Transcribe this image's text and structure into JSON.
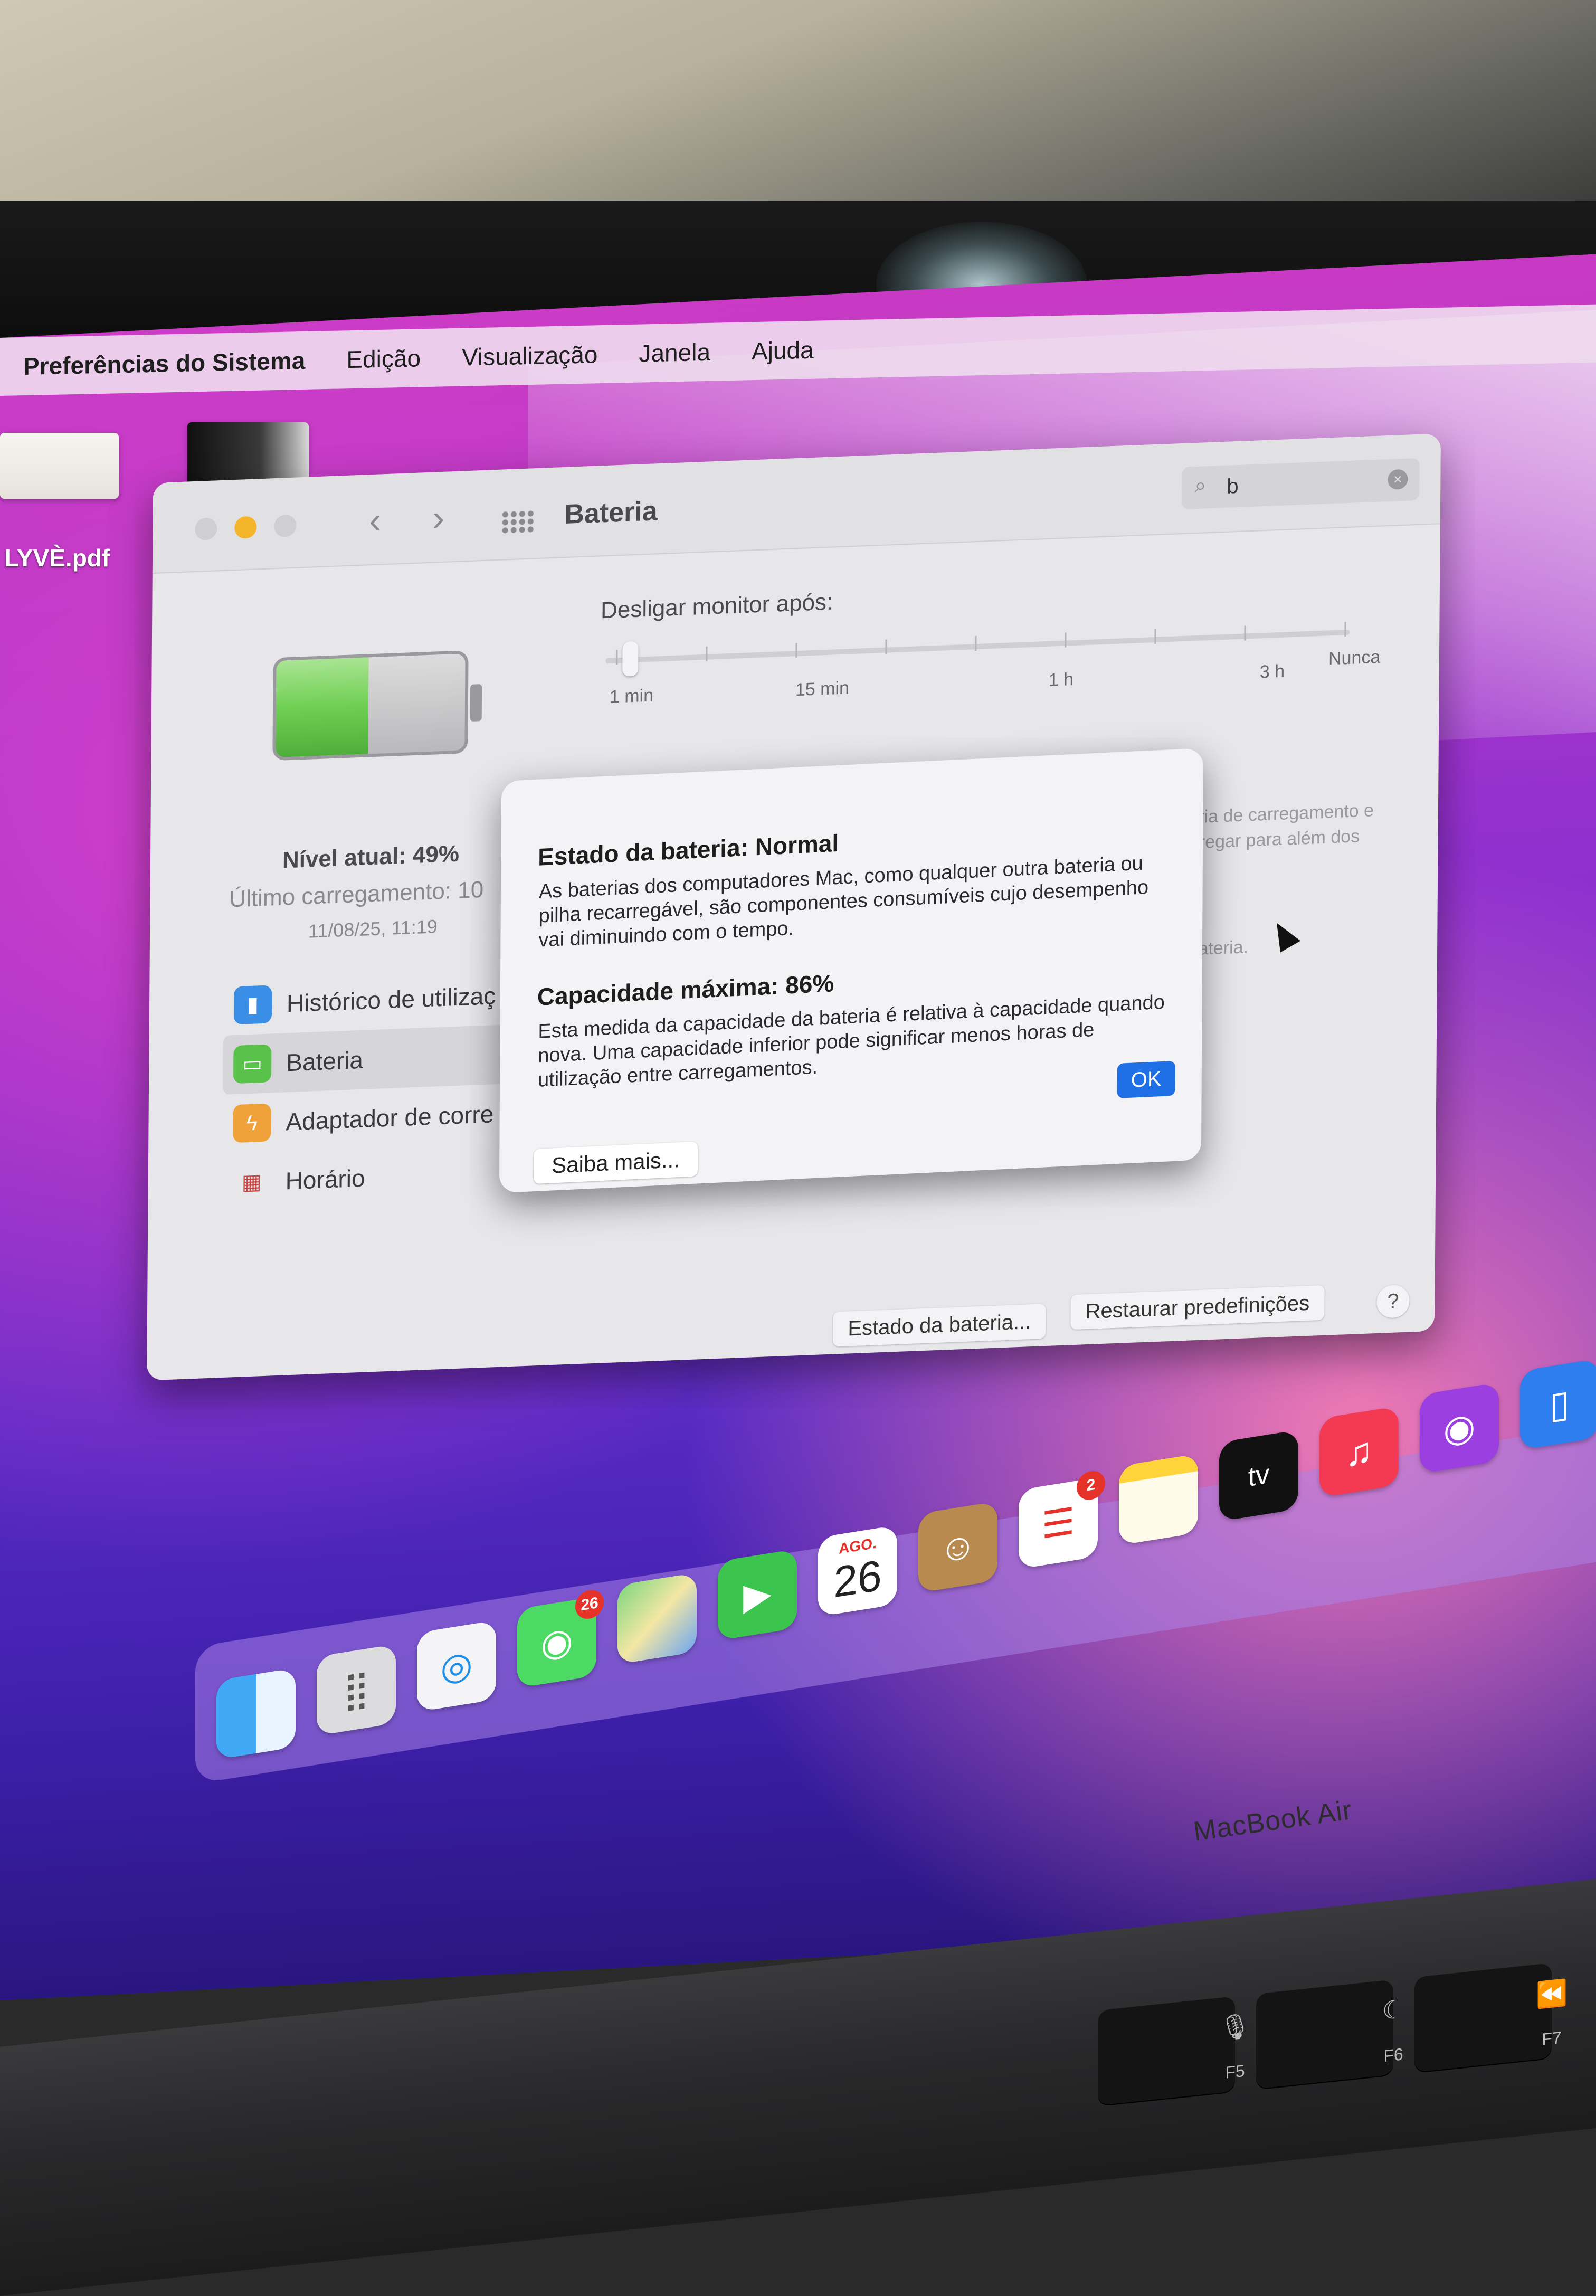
{
  "menubar": {
    "app_name": "Preferências do Sistema",
    "items": [
      "Edição",
      "Visualização",
      "Janela",
      "Ajuda"
    ]
  },
  "desktop": {
    "file_name": "LYVÈ.pdf"
  },
  "window": {
    "title": "Bateria",
    "search_query": "b",
    "battery": {
      "level_text": "Nível atual: 49%",
      "level_percent": 49,
      "last_charge_text": "Último carregamento: 10",
      "last_charge_date": "11/08/25, 11:19"
    },
    "slider": {
      "label": "Desligar monitor após:",
      "tick_labels": [
        "1 min",
        "15 min",
        "1 h",
        "3 h",
        "Nunca"
      ],
      "value": "1 min"
    },
    "sidebar": [
      {
        "label": "Histórico de utilizaç",
        "icon": "bar-chart-icon",
        "color": "#3a8ee6",
        "selected": false
      },
      {
        "label": "Bateria",
        "icon": "battery-icon",
        "color": "#58c24a",
        "selected": true
      },
      {
        "label": "Adaptador de corre",
        "icon": "bolt-icon",
        "color": "#f0a23a",
        "selected": false
      },
      {
        "label": "Horário",
        "icon": "calendar-icon",
        "color": "#e8e8ea",
        "selected": false
      }
    ],
    "obscured_text": {
      "line1": "diária de carregamento e",
      "line2": "carregar para além dos",
      "line3": "a bateria."
    },
    "buttons": {
      "battery_state": "Estado da bateria...",
      "restore_defaults": "Restaurar predefinições",
      "help": "?"
    }
  },
  "dialog": {
    "heading1": "Estado da bateria: Normal",
    "text1": "As baterias dos computadores Mac, como qualquer outra bateria ou pilha recarregável, são componentes consumíveis cujo desempenho vai diminuindo com o tempo.",
    "heading2": "Capacidade máxima: 86%",
    "text2": "Esta medida da capacidade da bateria é relativa à capacidade quando nova. Uma capacidade inferior pode significar menos horas de utilização entre carregamentos.",
    "ok_label": "OK",
    "learn_more_label": "Saiba mais..."
  },
  "dock": {
    "messages_badge": "26",
    "calendar_month": "AGO.",
    "calendar_day": "26",
    "reminders_badge": "2",
    "tv_label": "tv"
  },
  "hardware": {
    "model_label": "MacBook Air",
    "keys": [
      "F5",
      "F6",
      "F7"
    ]
  }
}
